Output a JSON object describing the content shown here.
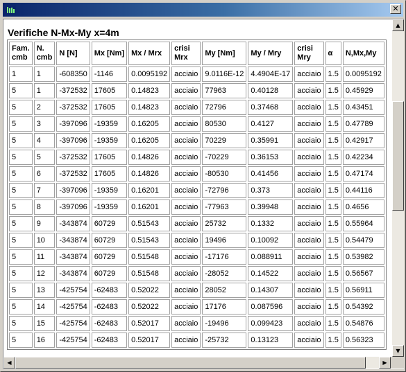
{
  "window": {
    "title": "",
    "close_symbol": "✕"
  },
  "report": {
    "title": "Verifiche N-Mx-My x=4m",
    "columns": [
      [
        "Fam.",
        "cmb"
      ],
      [
        "N.",
        "cmb"
      ],
      [
        "N [N]"
      ],
      [
        "Mx [Nm]"
      ],
      [
        "Mx / Mrx"
      ],
      [
        "crisi",
        "Mrx"
      ],
      [
        "My [Nm]"
      ],
      [
        "My / Mry"
      ],
      [
        "crisi",
        "Mry"
      ],
      [
        "α"
      ],
      [
        "N,Mx,My"
      ]
    ],
    "rows": [
      [
        "1",
        "1",
        "-608350",
        "-1146",
        "0.0095192",
        "acciaio",
        "9.0116E-12",
        "4.4904E-17",
        "acciaio",
        "1.5",
        "0.0095192"
      ],
      [
        "5",
        "1",
        "-372532",
        "17605",
        "0.14823",
        "acciaio",
        "77963",
        "0.40128",
        "acciaio",
        "1.5",
        "0.45929"
      ],
      [
        "5",
        "2",
        "-372532",
        "17605",
        "0.14823",
        "acciaio",
        "72796",
        "0.37468",
        "acciaio",
        "1.5",
        "0.43451"
      ],
      [
        "5",
        "3",
        "-397096",
        "-19359",
        "0.16205",
        "acciaio",
        "80530",
        "0.4127",
        "acciaio",
        "1.5",
        "0.47789"
      ],
      [
        "5",
        "4",
        "-397096",
        "-19359",
        "0.16205",
        "acciaio",
        "70229",
        "0.35991",
        "acciaio",
        "1.5",
        "0.42917"
      ],
      [
        "5",
        "5",
        "-372532",
        "17605",
        "0.14826",
        "acciaio",
        "-70229",
        "0.36153",
        "acciaio",
        "1.5",
        "0.42234"
      ],
      [
        "5",
        "6",
        "-372532",
        "17605",
        "0.14826",
        "acciaio",
        "-80530",
        "0.41456",
        "acciaio",
        "1.5",
        "0.47174"
      ],
      [
        "5",
        "7",
        "-397096",
        "-19359",
        "0.16201",
        "acciaio",
        "-72796",
        "0.373",
        "acciaio",
        "1.5",
        "0.44116"
      ],
      [
        "5",
        "8",
        "-397096",
        "-19359",
        "0.16201",
        "acciaio",
        "-77963",
        "0.39948",
        "acciaio",
        "1.5",
        "0.4656"
      ],
      [
        "5",
        "9",
        "-343874",
        "60729",
        "0.51543",
        "acciaio",
        "25732",
        "0.1332",
        "acciaio",
        "1.5",
        "0.55964"
      ],
      [
        "5",
        "10",
        "-343874",
        "60729",
        "0.51543",
        "acciaio",
        "19496",
        "0.10092",
        "acciaio",
        "1.5",
        "0.54479"
      ],
      [
        "5",
        "11",
        "-343874",
        "60729",
        "0.51548",
        "acciaio",
        "-17176",
        "0.088911",
        "acciaio",
        "1.5",
        "0.53982"
      ],
      [
        "5",
        "12",
        "-343874",
        "60729",
        "0.51548",
        "acciaio",
        "-28052",
        "0.14522",
        "acciaio",
        "1.5",
        "0.56567"
      ],
      [
        "5",
        "13",
        "-425754",
        "-62483",
        "0.52022",
        "acciaio",
        "28052",
        "0.14307",
        "acciaio",
        "1.5",
        "0.56911"
      ],
      [
        "5",
        "14",
        "-425754",
        "-62483",
        "0.52022",
        "acciaio",
        "17176",
        "0.087596",
        "acciaio",
        "1.5",
        "0.54392"
      ],
      [
        "5",
        "15",
        "-425754",
        "-62483",
        "0.52017",
        "acciaio",
        "-19496",
        "0.099423",
        "acciaio",
        "1.5",
        "0.54876"
      ],
      [
        "5",
        "16",
        "-425754",
        "-62483",
        "0.52017",
        "acciaio",
        "-25732",
        "0.13123",
        "acciaio",
        "1.5",
        "0.56323"
      ]
    ]
  },
  "scrollbars": {
    "up_arrow": "▲",
    "down_arrow": "▼",
    "left_arrow": "◀",
    "right_arrow": "▶"
  },
  "colors": {
    "titlebar_start": "#0a246a",
    "titlebar_end": "#a6caf0",
    "window_face": "#d4d0c8"
  }
}
